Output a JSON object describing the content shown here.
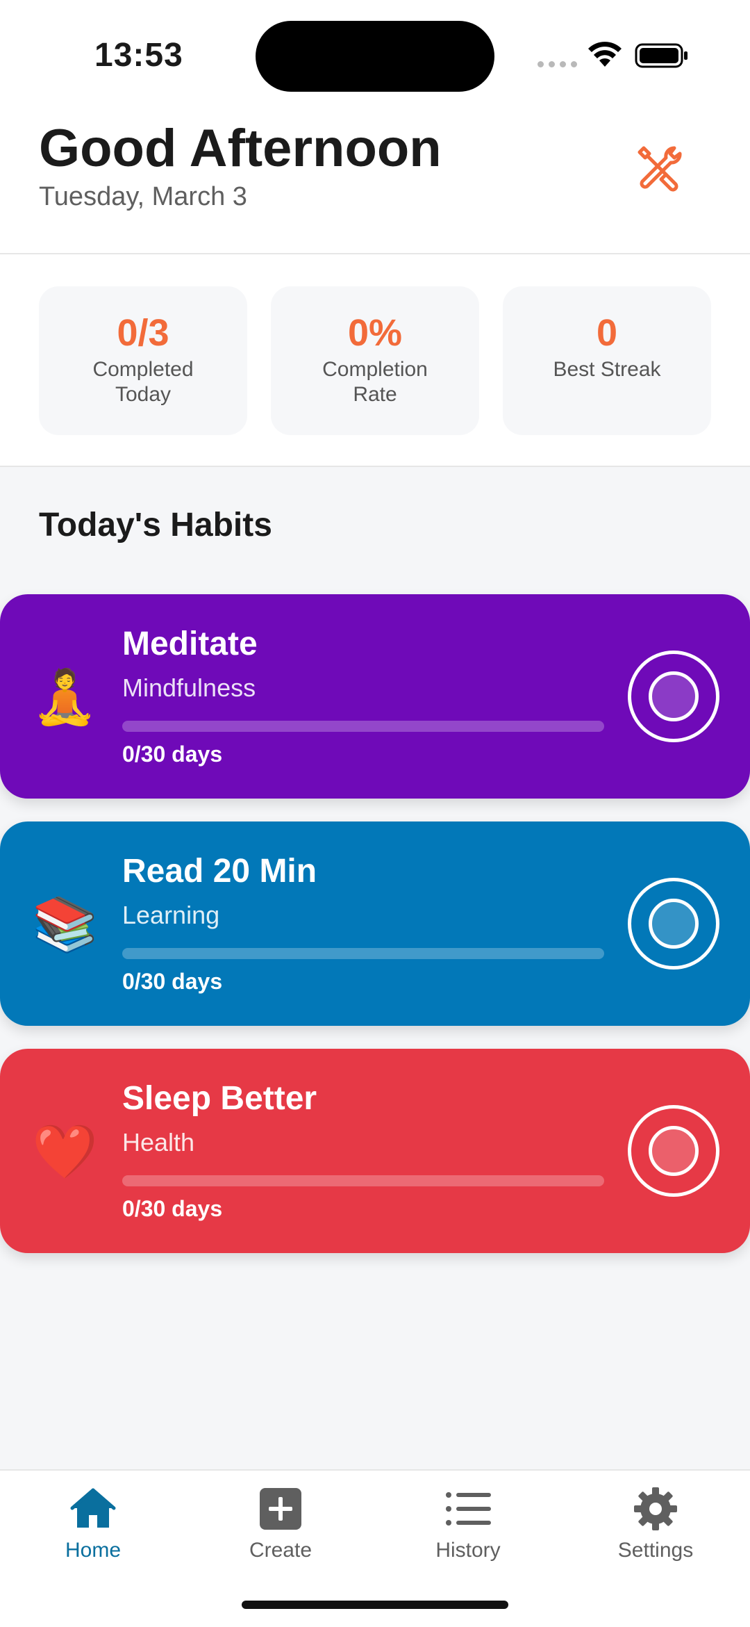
{
  "status_bar": {
    "time": "13:53"
  },
  "header": {
    "greeting": "Good Afternoon",
    "date": "Tuesday, March 3"
  },
  "stats": [
    {
      "value": "0/3",
      "label": "Completed Today"
    },
    {
      "value": "0%",
      "label": "Completion Rate"
    },
    {
      "value": "0",
      "label": "Best Streak"
    }
  ],
  "habits_title": "Today's Habits",
  "habits": [
    {
      "name": "Meditate",
      "category": "Mindfulness",
      "emoji": "🧘",
      "progress_text": "0/30 days",
      "progress": 0,
      "color": "#6f0ab8"
    },
    {
      "name": "Read 20 Min",
      "category": "Learning",
      "emoji": "📚",
      "progress_text": "0/30 days",
      "progress": 0,
      "color": "#0278b8"
    },
    {
      "name": "Sleep Better",
      "category": "Health",
      "emoji": "❤️",
      "progress_text": "0/30 days",
      "progress": 0,
      "color": "#e63946"
    }
  ],
  "tabs": [
    {
      "label": "Home",
      "icon": "home-icon",
      "active": true
    },
    {
      "label": "Create",
      "icon": "plus-square-icon",
      "active": false
    },
    {
      "label": "History",
      "icon": "list-icon",
      "active": false
    },
    {
      "label": "Settings",
      "icon": "gear-icon",
      "active": false
    }
  ],
  "colors": {
    "accent": "#f26b3a",
    "active_tab": "#0a6f9e"
  }
}
